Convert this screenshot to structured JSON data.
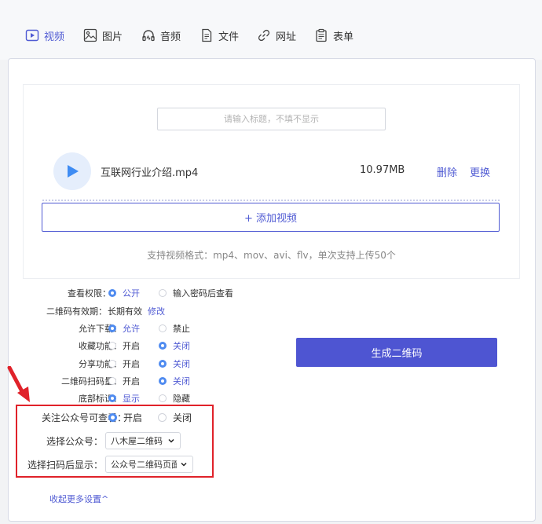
{
  "tabs": [
    {
      "label": "视频",
      "icon": "play-square-icon",
      "active": true
    },
    {
      "label": "图片",
      "icon": "image-icon"
    },
    {
      "label": "音频",
      "icon": "headphones-icon"
    },
    {
      "label": "文件",
      "icon": "file-icon"
    },
    {
      "label": "网址",
      "icon": "link-icon"
    },
    {
      "label": "表单",
      "icon": "clipboard-icon"
    }
  ],
  "upload": {
    "title_placeholder": "请输入标题，不填不显示",
    "file_name": "互联网行业介绍.mp4",
    "file_size": "10.97MB",
    "delete_label": "删除",
    "change_label": "更换",
    "add_button": "+ 添加视频",
    "hint": "支持视频格式：mp4、mov、avi、flv，单次支持上传50个"
  },
  "settings": {
    "view_permission": {
      "label": "查看权限：",
      "options": [
        "公开",
        "输入密码后查看"
      ],
      "selected": 0
    },
    "validity": {
      "label": "二维码有效期：",
      "value": "长期有效",
      "edit": "修改"
    },
    "download": {
      "label": "允许下载：",
      "options": [
        "允许",
        "禁止"
      ],
      "selected": 0
    },
    "favorite": {
      "label": "收藏功能：",
      "options": [
        "开启",
        "关闭"
      ],
      "selected": 1
    },
    "share": {
      "label": "分享功能：",
      "options": [
        "开启",
        "关闭"
      ],
      "selected": 1
    },
    "scan_count": {
      "label": "二维码扫码量：",
      "options": [
        "开启",
        "关闭"
      ],
      "selected": 1
    },
    "footer_mark": {
      "label": "底部标识：",
      "options": [
        "显示",
        "隐藏"
      ],
      "selected": 0
    },
    "follow_required": {
      "label": "关注公众号可查看：",
      "options": [
        "开启",
        "关闭"
      ],
      "selected": 0
    },
    "choose_account": {
      "label": "选择公众号：",
      "value": "八木屋二维码"
    },
    "after_scan": {
      "label": "选择扫码后显示：",
      "value": "公众号二维码页面"
    }
  },
  "generate_button": "生成二维码",
  "collapse_link": "收起更多设置^",
  "colors": {
    "accent": "#4f5ad3",
    "button": "#4e55d2",
    "highlight_box": "#e0222a",
    "radio_on": "#4f8bf0"
  }
}
